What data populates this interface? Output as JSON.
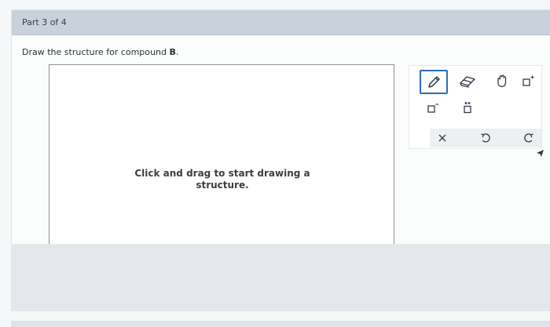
{
  "part": {
    "label": "Part 3 of 4"
  },
  "prompt": {
    "text_before": "Draw the structure for compound ",
    "compound": "B",
    "text_after": "."
  },
  "canvas": {
    "hint": "Click and drag to start drawing a structure."
  },
  "toolbar": {
    "tools": [
      {
        "name": "pencil-tool",
        "icon": "pencil-icon",
        "selected": true
      },
      {
        "name": "eraser-tool",
        "icon": "eraser-icon",
        "selected": false
      },
      {
        "name": "hand-tool",
        "icon": "hand-icon",
        "selected": false
      },
      {
        "name": "charge-plus-tool",
        "icon": "charge-plus-icon",
        "selected": false
      },
      {
        "name": "charge-minus-tool",
        "icon": "charge-minus-icon",
        "selected": false
      },
      {
        "name": "lone-pair-tool",
        "icon": "lone-pair-icon",
        "selected": false
      },
      {
        "name": "clear-tool",
        "icon": "close-icon",
        "selected": false
      },
      {
        "name": "undo-tool",
        "icon": "undo-icon",
        "selected": false
      },
      {
        "name": "redo-tool",
        "icon": "redo-icon",
        "selected": false
      }
    ],
    "accent": "#2a6fbb"
  }
}
